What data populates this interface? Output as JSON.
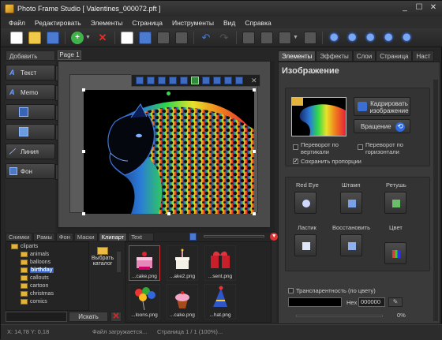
{
  "window": {
    "title": "Photo Frame Studio [ Valentines_000072.pft ]",
    "controls": [
      "_",
      "☐",
      "✕"
    ]
  },
  "menu": [
    "Файл",
    "Редактировать",
    "Элементы",
    "Страница",
    "Инструменты",
    "Вид",
    "Справка"
  ],
  "left_panel": {
    "header": "Добавить",
    "buttons": [
      {
        "label": "Текст",
        "icon": "text-icon"
      },
      {
        "label": "Memo",
        "icon": "memo-icon"
      },
      {
        "label": "",
        "icon": "frame-icon"
      },
      {
        "label": "",
        "icon": "image-icon"
      },
      {
        "label": "Линия",
        "icon": "line-icon"
      },
      {
        "label": "Фон",
        "icon": "background-icon"
      }
    ]
  },
  "canvas": {
    "page_tab": "Page 1"
  },
  "right_panel": {
    "tabs": [
      "Элементы",
      "Эффекты",
      "Слои",
      "Страница",
      "Наст"
    ],
    "active_tab": "Элементы",
    "title": "Изображение",
    "crop_label": "Кадрировать изображение",
    "rotate_label": "Вращение",
    "flip_vertical": "Переворот по вертикали",
    "flip_horizontal": "Переворот по горизонтали",
    "keep_proportions": "Сохранить пропорции",
    "tools": [
      "Red Eye",
      "Штамп",
      "Ретушь",
      "Ластик",
      "Восстановить",
      "Цвет"
    ],
    "transparency_label": "Транспарентность (по цвету)",
    "hex_label": "Hex",
    "hex_value": "000000",
    "percent": "0%"
  },
  "bottom_tabs": [
    "Снимки",
    "Рамы",
    "Фон",
    "Маски",
    "Клипарт",
    "Text FX"
  ],
  "active_bottom_tab": "Клипарт",
  "tree": {
    "root": "cliparts",
    "items": [
      "animals",
      "balloons",
      "birthday",
      "callouts",
      "cartoon",
      "christmas",
      "comics"
    ],
    "selected": "birthday"
  },
  "select_catalog": "Выбрать каталог",
  "search_button": "Искать",
  "cliparts": [
    {
      "label": "...cake.png"
    },
    {
      "label": "...ake2.png"
    },
    {
      "label": "...sent.png"
    },
    {
      "label": "...loons.png"
    },
    {
      "label": "...cake.png"
    },
    {
      "label": "...hat.png"
    }
  ],
  "status": {
    "coords": "X: 14,78  Y: 0,18",
    "message": "Файл загружается...",
    "page": "Страница 1 / 1 (100%)..."
  }
}
